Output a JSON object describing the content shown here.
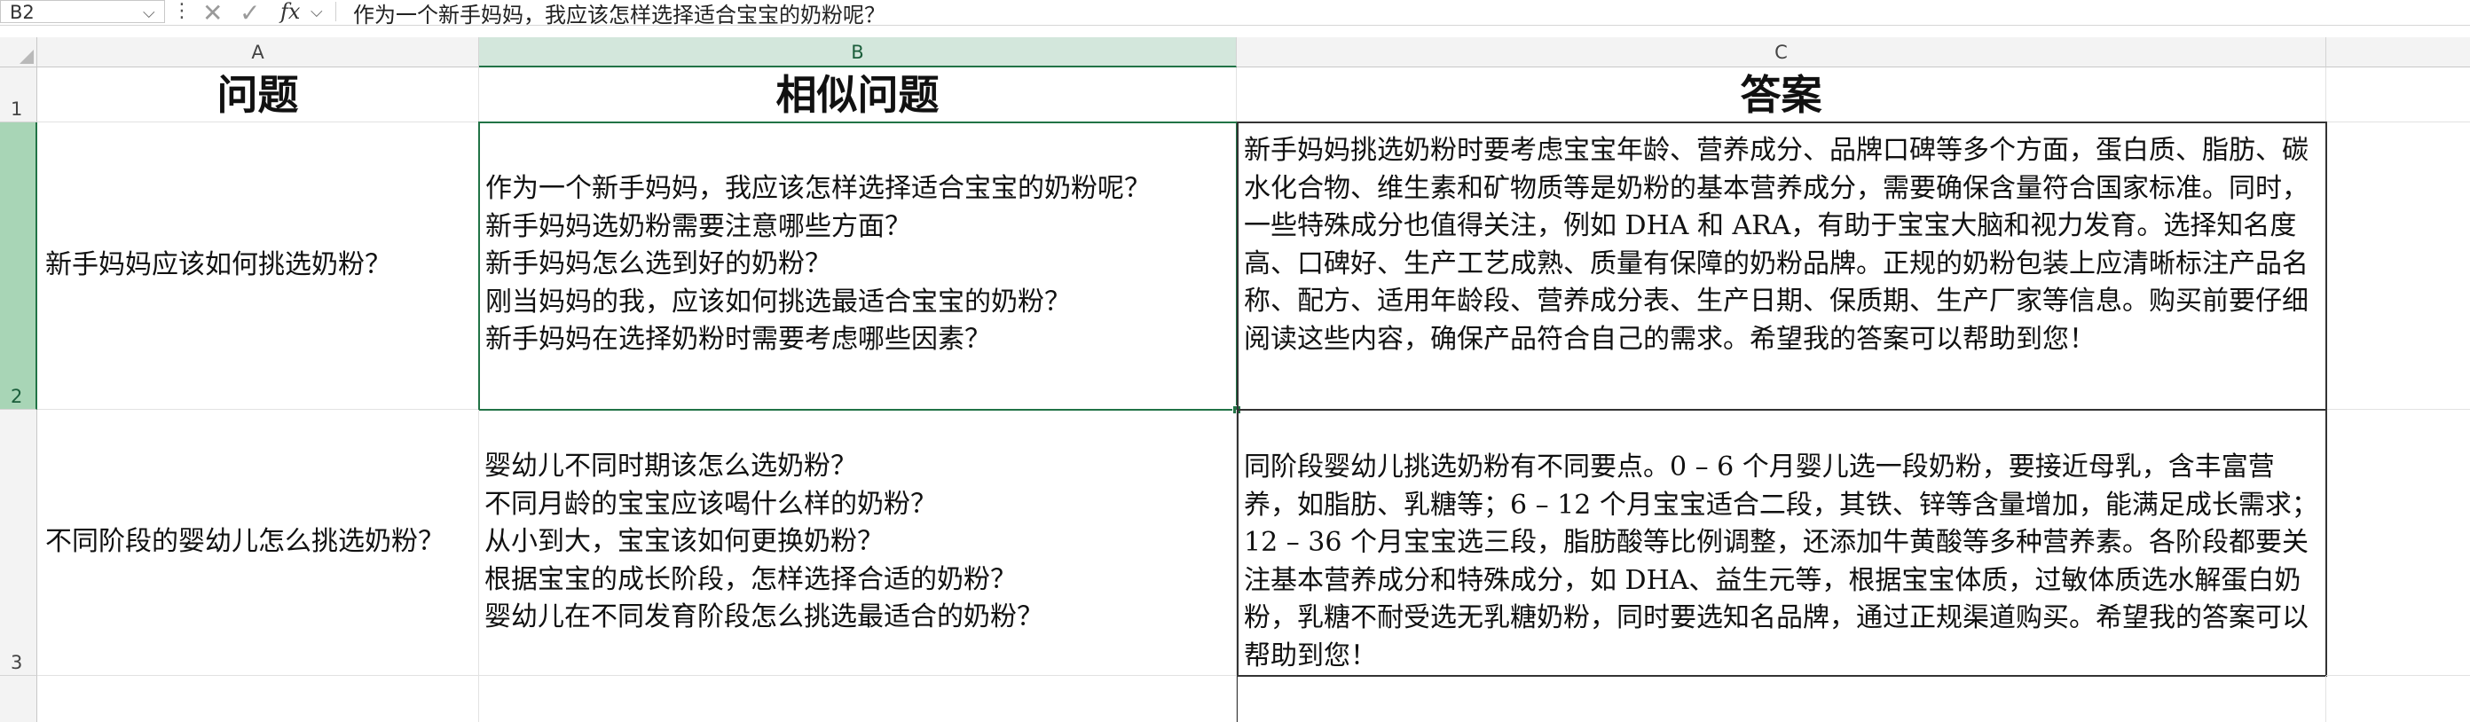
{
  "formula_bar": {
    "name_box": "B2",
    "fx_label": "fx",
    "content": "作为一个新手妈妈，我应该怎样选择适合宝宝的奶粉呢？"
  },
  "columns": [
    {
      "label": "A"
    },
    {
      "label": "B"
    },
    {
      "label": "C"
    }
  ],
  "rows": [
    {
      "label": "1"
    },
    {
      "label": "2"
    },
    {
      "label": "3"
    }
  ],
  "header": {
    "a": "问题",
    "b": "相似问题",
    "c": "答案"
  },
  "data_rows": [
    {
      "question": "新手妈妈应该如何挑选奶粉？",
      "similar": "作为一个新手妈妈，我应该怎样选择适合宝宝的奶粉呢？\n新手妈妈选奶粉需要注意哪些方面？\n新手妈妈怎么选到好的奶粉？\n刚当妈妈的我，应该如何挑选最适合宝宝的奶粉？\n新手妈妈在选择奶粉时需要考虑哪些因素？",
      "answer": "新手妈妈挑选奶粉时要考虑宝宝年龄、营养成分、品牌口碑等多个方面，蛋白质、脂肪、碳水化合物、维生素和矿物质等是奶粉的基本营养成分，需要确保含量符合国家标准。同时，一些特殊成分也值得关注，例如 DHA 和 ARA，有助于宝宝大脑和视力发育。选择知名度高、口碑好、生产工艺成熟、质量有保障的奶粉品牌。正规的奶粉包装上应清晰标注产品名称、配方、适用年龄段、营养成分表、生产日期、保质期、生产厂家等信息。购买前要仔细阅读这些内容，确保产品符合自己的需求。希望我的答案可以帮助到您！"
    },
    {
      "question": "不同阶段的婴幼儿怎么挑选奶粉？",
      "similar": "婴幼儿不同时期该怎么选奶粉？\n不同月龄的宝宝应该喝什么样的奶粉？\n从小到大，宝宝该如何更换奶粉？\n根据宝宝的成长阶段，怎样选择合适的奶粉？\n婴幼儿在不同发育阶段怎么挑选最适合的奶粉？",
      "answer": "同阶段婴幼儿挑选奶粉有不同要点。0 – 6 个月婴儿选一段奶粉，要接近母乳，含丰富营养，如脂肪、乳糖等；6 – 12 个月宝宝适合二段，其铁、锌等含量增加，能满足成长需求；12 – 36 个月宝宝选三段，脂肪酸等比例调整，还添加牛黄酸等多种营养素。各阶段都要关注基本营养成分和特殊成分，如 DHA、益生元等，根据宝宝体质，过敏体质选水解蛋白奶粉，乳糖不耐受选无乳糖奶粉，同时要选知名品牌，通过正规渠道购买。希望我的答案可以帮助到您！"
    }
  ]
}
